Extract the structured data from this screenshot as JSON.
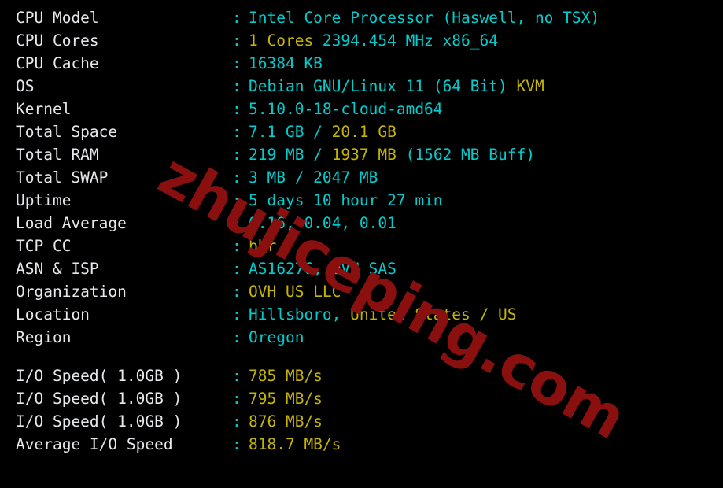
{
  "terminal": {
    "separator_glyph": "-",
    "separator_text": "-------------------------------------------------------------------------------------------",
    "colon": ":",
    "colors": {
      "background": "#000000",
      "label": "#e6e8ec",
      "cyan": "#00cdcd",
      "yellow": "#c6b500",
      "watermark": "#8a1010"
    }
  },
  "watermark": {
    "text": "zhujiceping.com"
  },
  "system_info": {
    "rows": [
      {
        "label": "CPU Model",
        "segments": [
          {
            "text": "Intel Core Processor (Haswell, no TSX)",
            "color": "cyan"
          }
        ]
      },
      {
        "label": "CPU Cores",
        "segments": [
          {
            "text": "1 Cores ",
            "color": "yellow"
          },
          {
            "text": "2394.454 MHz x86_64",
            "color": "cyan"
          }
        ]
      },
      {
        "label": "CPU Cache",
        "segments": [
          {
            "text": "16384 KB",
            "color": "cyan"
          }
        ]
      },
      {
        "label": "OS",
        "segments": [
          {
            "text": "Debian GNU/Linux 11 (64 Bit) ",
            "color": "cyan"
          },
          {
            "text": "KVM",
            "color": "yellow"
          }
        ]
      },
      {
        "label": "Kernel",
        "segments": [
          {
            "text": "5.10.0-18-cloud-amd64",
            "color": "cyan"
          }
        ]
      },
      {
        "label": "Total Space",
        "segments": [
          {
            "text": "7.1 GB / ",
            "color": "cyan"
          },
          {
            "text": "20.1 GB",
            "color": "yellow"
          }
        ]
      },
      {
        "label": "Total RAM",
        "segments": [
          {
            "text": "219 MB / ",
            "color": "cyan"
          },
          {
            "text": "1937 MB ",
            "color": "yellow"
          },
          {
            "text": "(1562 MB Buff)",
            "color": "cyan"
          }
        ]
      },
      {
        "label": "Total SWAP",
        "segments": [
          {
            "text": "3 MB / 2047 MB",
            "color": "cyan"
          }
        ]
      },
      {
        "label": "Uptime",
        "segments": [
          {
            "text": "5 days 10 hour 27 min",
            "color": "cyan"
          }
        ]
      },
      {
        "label": "Load Average",
        "segments": [
          {
            "text": "0.16, 0.04, 0.01",
            "color": "cyan"
          }
        ]
      },
      {
        "label": "TCP CC",
        "segments": [
          {
            "text": "bbr",
            "color": "yellow"
          }
        ]
      },
      {
        "label": "ASN & ISP",
        "segments": [
          {
            "text": "AS16276, OVH SAS",
            "color": "cyan"
          }
        ]
      },
      {
        "label": "Organization",
        "segments": [
          {
            "text": "OVH US LLC",
            "color": "yellow"
          }
        ]
      },
      {
        "label": "Location",
        "segments": [
          {
            "text": "Hillsboro, ",
            "color": "cyan"
          },
          {
            "text": "United States / US",
            "color": "yellow"
          }
        ]
      },
      {
        "label": "Region",
        "segments": [
          {
            "text": "Oregon",
            "color": "cyan"
          }
        ]
      }
    ]
  },
  "io_speed": {
    "rows": [
      {
        "label": "I/O Speed( 1.0GB )",
        "segments": [
          {
            "text": "785 MB/s",
            "color": "yellow"
          }
        ]
      },
      {
        "label": "I/O Speed( 1.0GB )",
        "segments": [
          {
            "text": "795 MB/s",
            "color": "yellow"
          }
        ]
      },
      {
        "label": "I/O Speed( 1.0GB )",
        "segments": [
          {
            "text": "876 MB/s",
            "color": "yellow"
          }
        ]
      },
      {
        "label": "Average I/O Speed",
        "segments": [
          {
            "text": "818.7 MB/s",
            "color": "yellow"
          }
        ]
      }
    ]
  }
}
